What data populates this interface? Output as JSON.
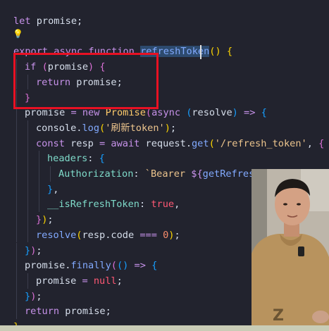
{
  "editor": {
    "lines": [
      {
        "indent": 0,
        "tokens": [
          [
            "kw",
            "let"
          ],
          [
            "var",
            " promise"
          ],
          [
            "punc",
            ";"
          ]
        ]
      },
      {
        "indent": 0,
        "tokens": []
      },
      {
        "indent": 0,
        "tokens": [
          [
            "kw",
            "export async function "
          ],
          [
            "fn",
            "refreshToken"
          ],
          [
            "br1",
            "()"
          ],
          [
            "punc",
            " "
          ],
          [
            "br1",
            "{"
          ]
        ]
      },
      {
        "indent": 1,
        "tokens": [
          [
            "ctl",
            "if "
          ],
          [
            "br2",
            "("
          ],
          [
            "var",
            "promise"
          ],
          [
            "br2",
            ")"
          ],
          [
            "punc",
            " "
          ],
          [
            "br2",
            "{"
          ]
        ]
      },
      {
        "indent": 2,
        "tokens": [
          [
            "ctl",
            "return "
          ],
          [
            "var",
            "promise"
          ],
          [
            "punc",
            ";"
          ]
        ]
      },
      {
        "indent": 1,
        "tokens": [
          [
            "br2",
            "}"
          ]
        ]
      },
      {
        "indent": 1,
        "tokens": [
          [
            "var",
            "promise "
          ],
          [
            "op",
            "="
          ],
          [
            "kw",
            " new "
          ],
          [
            "cls",
            "Promise"
          ],
          [
            "br2",
            "("
          ],
          [
            "kw",
            "async "
          ],
          [
            "br3",
            "("
          ],
          [
            "var",
            "resolve"
          ],
          [
            "br3",
            ")"
          ],
          [
            "kw",
            " =>"
          ],
          [
            "punc",
            " "
          ],
          [
            "br3",
            "{"
          ]
        ]
      },
      {
        "indent": 2,
        "tokens": [
          [
            "var",
            "console"
          ],
          [
            "punc",
            "."
          ],
          [
            "fn",
            "log"
          ],
          [
            "br1",
            "("
          ],
          [
            "str",
            "'刷新token'"
          ],
          [
            "br1",
            ")"
          ],
          [
            "punc",
            ";"
          ]
        ]
      },
      {
        "indent": 2,
        "tokens": [
          [
            "kw",
            "const "
          ],
          [
            "var",
            "resp "
          ],
          [
            "op",
            "= "
          ],
          [
            "kw",
            "await "
          ],
          [
            "var",
            "request"
          ],
          [
            "punc",
            "."
          ],
          [
            "fn",
            "get"
          ],
          [
            "br1",
            "("
          ],
          [
            "str",
            "'/refresh_token'"
          ],
          [
            "punc",
            ", "
          ],
          [
            "br2",
            "{"
          ]
        ]
      },
      {
        "indent": 3,
        "tokens": [
          [
            "prop",
            "headers"
          ],
          [
            "punc",
            ": "
          ],
          [
            "br3",
            "{"
          ]
        ]
      },
      {
        "indent": 4,
        "tokens": [
          [
            "prop",
            "Authorization"
          ],
          [
            "punc",
            ": "
          ],
          [
            "str",
            "`Bearer "
          ],
          [
            "kw",
            "${"
          ],
          [
            "fn",
            "getRefreshT"
          ]
        ]
      },
      {
        "indent": 3,
        "tokens": [
          [
            "br3",
            "}"
          ],
          [
            "punc",
            ","
          ]
        ]
      },
      {
        "indent": 3,
        "tokens": [
          [
            "prop",
            "__isRefreshToken"
          ],
          [
            "punc",
            ": "
          ],
          [
            "bool",
            "true"
          ],
          [
            "punc",
            ","
          ]
        ]
      },
      {
        "indent": 2,
        "tokens": [
          [
            "br2",
            "}"
          ],
          [
            "br1",
            ")"
          ],
          [
            "punc",
            ";"
          ]
        ]
      },
      {
        "indent": 2,
        "tokens": [
          [
            "fn",
            "resolve"
          ],
          [
            "br1",
            "("
          ],
          [
            "var",
            "resp"
          ],
          [
            "punc",
            "."
          ],
          [
            "var",
            "code "
          ],
          [
            "op",
            "=== "
          ],
          [
            "num",
            "0"
          ],
          [
            "br1",
            ")"
          ],
          [
            "punc",
            ";"
          ]
        ]
      },
      {
        "indent": 1,
        "tokens": [
          [
            "br3",
            "}"
          ],
          [
            "br2",
            ")"
          ],
          [
            "punc",
            ";"
          ]
        ]
      },
      {
        "indent": 1,
        "tokens": [
          [
            "var",
            "promise"
          ],
          [
            "punc",
            "."
          ],
          [
            "fn",
            "finally"
          ],
          [
            "br2",
            "("
          ],
          [
            "br3",
            "()"
          ],
          [
            "kw",
            " =>"
          ],
          [
            "punc",
            " "
          ],
          [
            "br3",
            "{"
          ]
        ]
      },
      {
        "indent": 2,
        "tokens": [
          [
            "var",
            "promise "
          ],
          [
            "op",
            "= "
          ],
          [
            "bool",
            "null"
          ],
          [
            "punc",
            ";"
          ]
        ]
      },
      {
        "indent": 1,
        "tokens": [
          [
            "br3",
            "}"
          ],
          [
            "br2",
            ")"
          ],
          [
            "punc",
            ";"
          ]
        ]
      },
      {
        "indent": 1,
        "tokens": [
          [
            "ctl",
            "return "
          ],
          [
            "var",
            "promise"
          ],
          [
            "punc",
            ";"
          ]
        ]
      },
      {
        "indent": 0,
        "tokens": [
          [
            "br1",
            "}"
          ]
        ]
      }
    ]
  },
  "colors": {
    "editor_bg": "#22232e",
    "highlight_box": "#e81123",
    "selection": "#2d4a6e",
    "lightbulb": "#f5c518"
  },
  "icons": {
    "lightbulb": "lightbulb-icon"
  },
  "webcam": {
    "shirt_text": "Z"
  }
}
